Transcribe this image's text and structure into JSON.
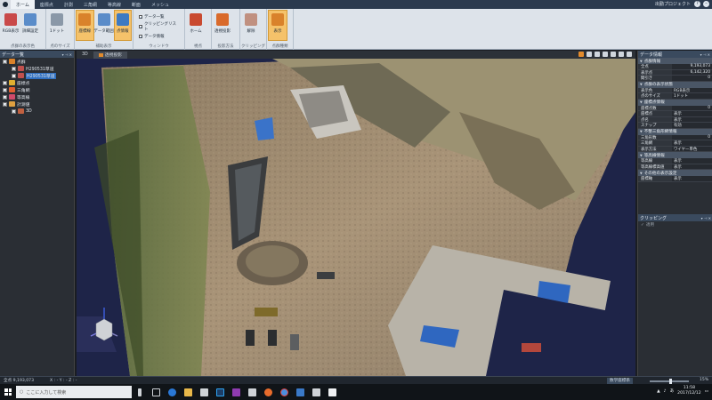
{
  "titlebar": {
    "tabs": [
      "ホーム",
      "座標点",
      "計測",
      "三角網",
      "等高線",
      "断面",
      "メッシュ"
    ],
    "active_tab": 0,
    "project_name": "出勤プロジェクト"
  },
  "ribbon": {
    "groups": [
      {
        "label": "点群の表示色",
        "buttons": [
          {
            "label": "RGB表示",
            "icon": "rgb-icon",
            "selected": false
          },
          {
            "label": "詳細設定",
            "icon": "settings-icon",
            "selected": false
          }
        ]
      },
      {
        "label": "点のサイズ",
        "buttons": [
          {
            "label": "1ドット",
            "icon": "dot-icon",
            "selected": false
          }
        ]
      },
      {
        "label": "補助表示",
        "buttons": [
          {
            "label": "座標線",
            "icon": "axis-line-icon",
            "selected": true
          },
          {
            "label": "データ範囲",
            "icon": "data-range-icon",
            "selected": false
          },
          {
            "label": "点情報",
            "icon": "point-info-icon",
            "selected": true
          }
        ]
      },
      {
        "label": "ウィンドウ",
        "checks": [
          "データ一覧",
          "クリッピングリスト",
          "データ情報"
        ]
      },
      {
        "label": "視点",
        "buttons": [
          {
            "label": "ホーム",
            "icon": "home-icon",
            "selected": false
          }
        ]
      },
      {
        "label": "投影方法",
        "buttons": [
          {
            "label": "透視投影",
            "icon": "projection-icon",
            "selected": false
          }
        ]
      },
      {
        "label": "クリッピング",
        "buttons": [
          {
            "label": "解除",
            "icon": "clip-release-icon",
            "selected": false
          }
        ]
      },
      {
        "label": "点群種類",
        "buttons": [
          {
            "label": "表示",
            "icon": "display-icon",
            "selected": true
          }
        ]
      }
    ]
  },
  "left_panel": {
    "title": "データ一覧",
    "tree": [
      {
        "label": "点群",
        "indent": 0,
        "checked": true,
        "color": "#d9822b"
      },
      {
        "label": "H290531草道",
        "indent": 2,
        "checked": true,
        "color": "#c0504d"
      },
      {
        "label": "H290531草道",
        "indent": 2,
        "checked": false,
        "color": "#c0504d",
        "selected": true
      },
      {
        "label": "座標点",
        "indent": 0,
        "checked": true,
        "color": "#e0b030"
      },
      {
        "label": "三角網",
        "indent": 0,
        "checked": true,
        "color": "#e06030"
      },
      {
        "label": "等高線",
        "indent": 0,
        "checked": true,
        "color": "#d04a6a"
      },
      {
        "label": "計測値",
        "indent": 0,
        "checked": true,
        "color": "#e0a040"
      },
      {
        "label": "3D",
        "indent": 2,
        "checked": true,
        "color": "#c06040"
      }
    ]
  },
  "viewport": {
    "tabs": [
      {
        "label": "3D",
        "active": false
      },
      {
        "label": "透視投影",
        "active": true
      }
    ]
  },
  "right_panel": {
    "title": "データ情報",
    "sections": [
      {
        "title": "点群情報",
        "rows": [
          [
            "全点",
            "9,193,073"
          ],
          [
            "表示点",
            "6,142,320"
          ],
          [
            "間引き",
            "0"
          ]
        ]
      },
      {
        "title": "点群の表示状態",
        "rows": [
          [
            "表示色",
            "RGB表示"
          ],
          [
            "点のサイズ",
            "1ドット"
          ]
        ]
      },
      {
        "title": "座標点情報",
        "rows": [
          [
            "座標点数",
            "0"
          ],
          [
            "座標点",
            "表示"
          ],
          [
            "点名",
            "表示"
          ],
          [
            "スナップ",
            "有効"
          ]
        ]
      },
      {
        "title": "不整三角形網情報",
        "rows": [
          [
            "三角形数",
            "0"
          ],
          [
            "三角網",
            "表示"
          ],
          [
            "表示方法",
            "ワイヤー単色"
          ]
        ]
      },
      {
        "title": "等高線情報",
        "rows": [
          [
            "等高線",
            "表示"
          ],
          [
            "等高線標高値",
            "表示"
          ]
        ]
      },
      {
        "title": "その他の表示設定",
        "rows": [
          [
            "座標軸",
            "表示"
          ]
        ]
      }
    ]
  },
  "clip_panel": {
    "title": "クリッピング",
    "item": "適用"
  },
  "statusbar": {
    "point_count": "全点 9,193,073",
    "coords": "X : - Y : - Z : -",
    "mode": "数学座標系",
    "zoom": "15%"
  },
  "taskbar": {
    "search_placeholder": "ここに入力して検索",
    "time": "11:58",
    "date": "2017/12/12"
  }
}
